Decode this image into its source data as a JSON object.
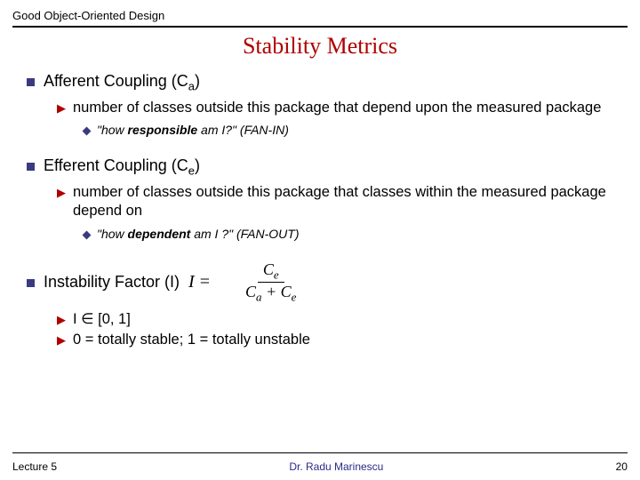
{
  "header": "Good Object-Oriented Design",
  "title": "Stability Metrics",
  "sections": [
    {
      "heading_pre": "Afferent Coupling (C",
      "heading_sub": "a",
      "heading_post": ")",
      "sub": [
        {
          "text": "number of classes outside this package that depend upon the measured package",
          "note_pre": "\"how ",
          "note_bold": "responsible",
          "note_post": " am I?\" (FAN-IN)"
        }
      ]
    },
    {
      "heading_pre": "Efferent Coupling (C",
      "heading_sub": "e",
      "heading_post": ")",
      "sub": [
        {
          "text": "number of classes outside this package that classes within the measured package depend on",
          "note_pre": "\"how ",
          "note_bold": "dependent",
          "note_post": " am I ?\" (FAN-OUT)"
        }
      ]
    },
    {
      "heading_pre": "Instability Factor (I)",
      "heading_sub": "",
      "heading_post": "",
      "formula": {
        "lhs": "I",
        "num_a": "C",
        "num_as": "e",
        "den_l": "C",
        "den_ls": "a",
        "den_r": "C",
        "den_rs": "e"
      },
      "sub2": [
        "I ∈ [0, 1]",
        "0 = totally stable; 1 = totally unstable"
      ]
    }
  ],
  "footer": {
    "left": "Lecture 5",
    "center": "Dr. Radu Marinescu",
    "right": "20"
  }
}
